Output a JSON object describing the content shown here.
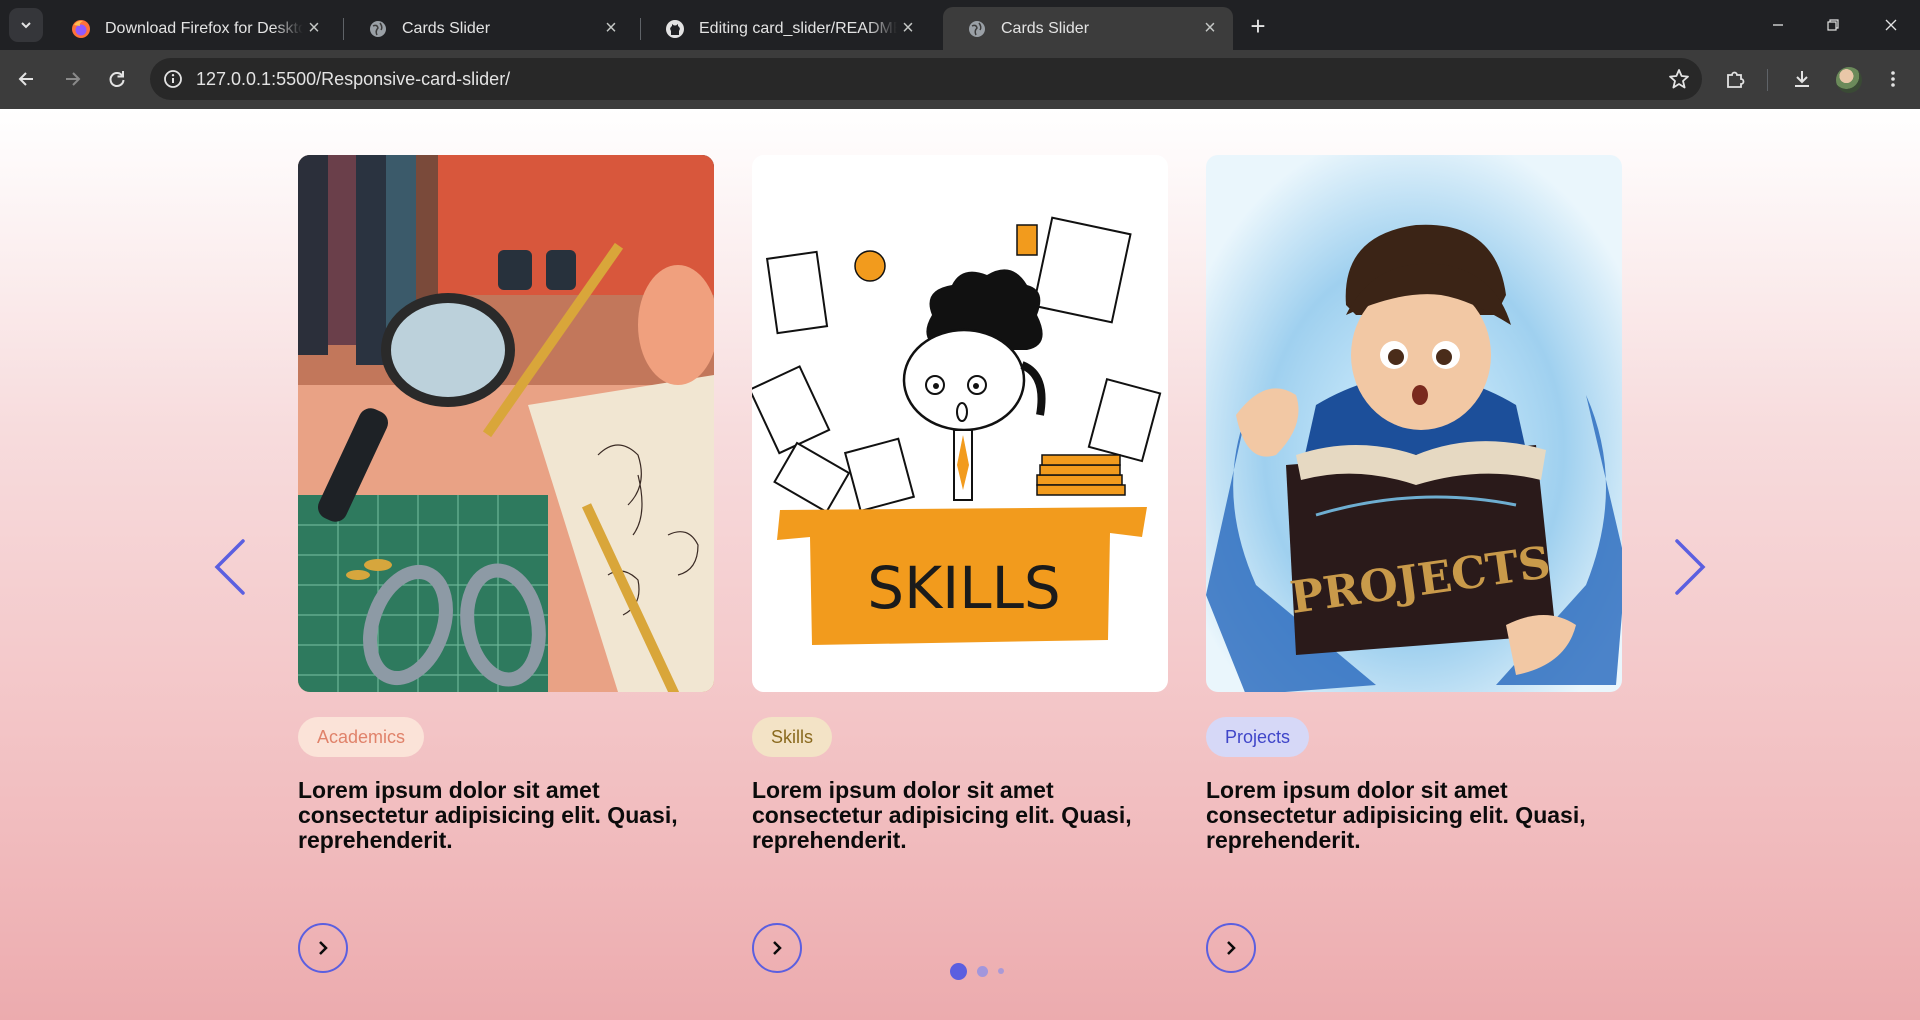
{
  "tabs": [
    {
      "title": "Download Firefox for Desktop — Mozilla",
      "favicon": "firefox-icon",
      "active": false
    },
    {
      "title": "Cards Slider",
      "favicon": "globe-icon",
      "active": false
    },
    {
      "title": "Editing card_slider/README.md",
      "favicon": "github-icon",
      "active": false
    },
    {
      "title": "Cards Slider",
      "favicon": "globe-icon",
      "active": true
    }
  ],
  "toolbar": {
    "url": "127.0.0.1:5500/Responsive-card-slider/"
  },
  "slider": {
    "cards": [
      {
        "badge": "Academics",
        "badge_bg": "#fbe3d8",
        "badge_color": "#e0826a",
        "image": "academics-illustration",
        "description": "Lorem ipsum dolor sit amet consectetur adipisicing elit. Quasi, reprehenderit."
      },
      {
        "badge": "Skills",
        "badge_bg": "#f3e3c6",
        "badge_color": "#8a6a1e",
        "image": "skills-illustration",
        "image_text": "SKILLS",
        "description": "Lorem ipsum dolor sit amet consectetur adipisicing elit. Quasi, reprehenderit."
      },
      {
        "badge": "Projects",
        "badge_bg": "#d6d8f7",
        "badge_color": "#3f45c9",
        "image": "projects-illustration",
        "image_text": "PROJECTS",
        "description": "Lorem ipsum dolor sit amet consectetur adipisicing elit. Quasi, reprehenderit."
      }
    ],
    "pagination": {
      "count": 3,
      "active_index": 0
    },
    "accent_color": "#5b5fe0"
  }
}
